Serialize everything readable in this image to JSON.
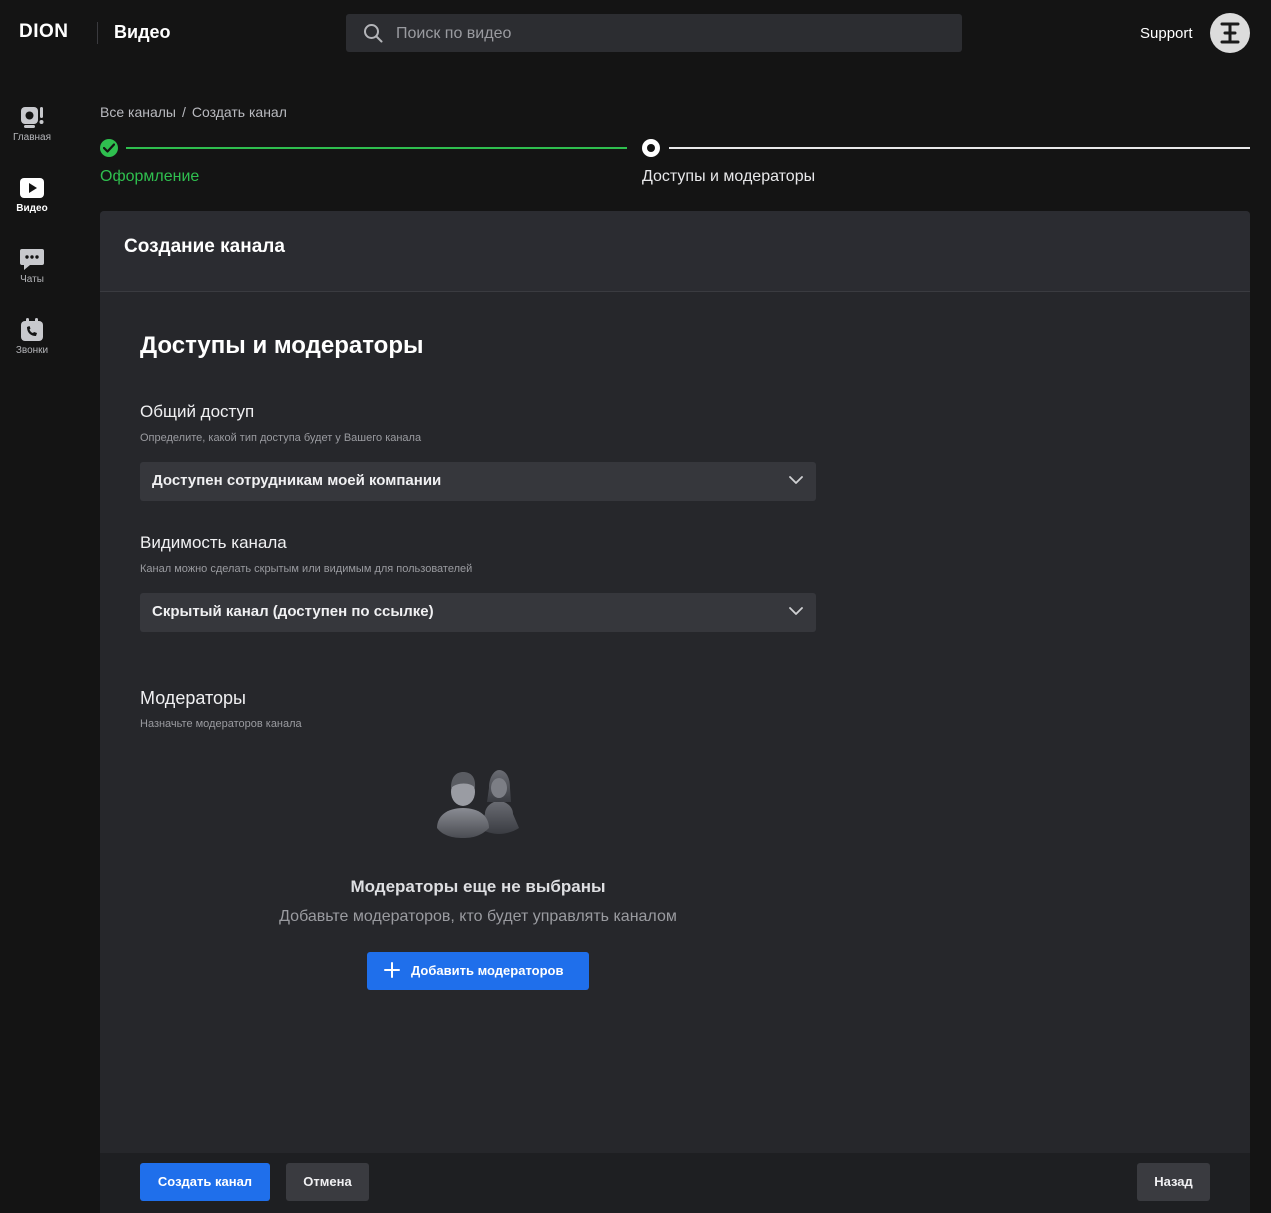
{
  "header": {
    "logo": "DION",
    "app_title": "Видео",
    "search_placeholder": "Поиск по видео",
    "support_label": "Support"
  },
  "sidebar": {
    "items": [
      {
        "label": "Главная",
        "icon": "home-icon"
      },
      {
        "label": "Видео",
        "icon": "video-icon",
        "active": true
      },
      {
        "label": "Чаты",
        "icon": "chat-icon"
      },
      {
        "label": "Звонки",
        "icon": "calls-icon"
      }
    ]
  },
  "breadcrumb": {
    "parent": "Все каналы",
    "separator": "/",
    "current": "Создать канал"
  },
  "stepper": {
    "steps": [
      {
        "label": "Оформление",
        "status": "completed"
      },
      {
        "label": "Доступы и модераторы",
        "status": "current"
      }
    ]
  },
  "card": {
    "title": "Создание канала",
    "section_title": "Доступы и модераторы",
    "access": {
      "label": "Общий доступ",
      "hint": "Определите, какой тип доступа будет у Вашего канала",
      "value": "Доступен сотрудникам моей компании"
    },
    "visibility": {
      "label": "Видимость канала",
      "hint": "Канал можно сделать скрытым или видимым для пользователей",
      "value": "Скрытый канал (доступен по ссылке)"
    },
    "moderators": {
      "label": "Модераторы",
      "hint": "Назначьте модераторов канала",
      "empty_title": "Модераторы еще не выбраны",
      "empty_subtitle": "Добавьте модераторов, кто будет управлять каналом",
      "add_button": "Добавить модераторов"
    }
  },
  "footer": {
    "create_button": "Создать канал",
    "cancel_button": "Отмена",
    "back_button": "Назад"
  },
  "colors": {
    "background": "#141414",
    "card": "#26272b",
    "accent": "#1f6feb",
    "success": "#2fbf4f"
  }
}
